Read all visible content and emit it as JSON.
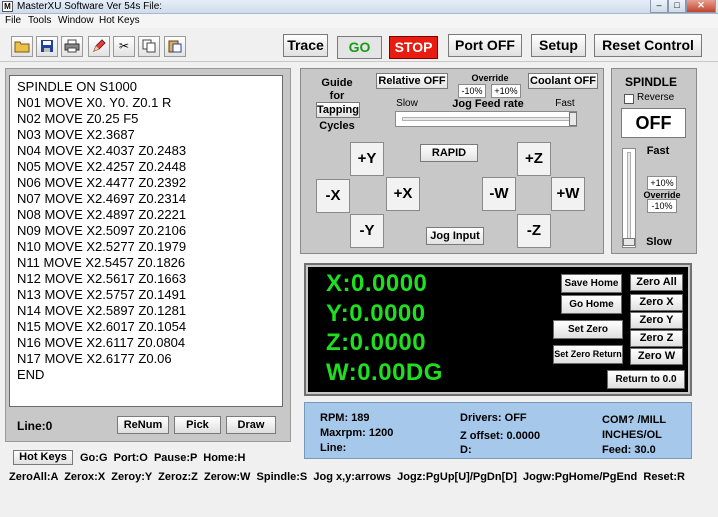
{
  "window": {
    "title": "MasterXU Software Ver 54s File:"
  },
  "menu": [
    "File",
    "Tools",
    "Window",
    "Hot Keys"
  ],
  "toolbar": {
    "tools": [
      "open-folder",
      "save",
      "print",
      "edit",
      "cut",
      "copy",
      "paste"
    ],
    "trace": "Trace",
    "go": "GO",
    "stop": "STOP",
    "port_off": "Port OFF",
    "setup": "Setup",
    "reset_control": "Reset Control"
  },
  "gcode": {
    "lines": [
      "SPINDLE ON S1000",
      "N01 MOVE X0. Y0. Z0.1 R",
      "N02 MOVE Z0.25 F5",
      "N03 MOVE X2.3687",
      "N04 MOVE X2.4037 Z0.2483",
      "N05 MOVE X2.4257 Z0.2448",
      "N06 MOVE X2.4477 Z0.2392",
      "N07 MOVE X2.4697 Z0.2314",
      "N08 MOVE X2.4897 Z0.2221",
      "N09 MOVE X2.5097 Z0.2106",
      "N10 MOVE X2.5277 Z0.1979",
      "N11 MOVE X2.5457 Z0.1826",
      "N12 MOVE X2.5617 Z0.1663",
      "N13 MOVE X2.5757 Z0.1491",
      "N14 MOVE X2.5897 Z0.1281",
      "N15 MOVE X2.6017 Z0.1054",
      "N16 MOVE X2.6117 Z0.0804",
      "N17 MOVE X2.6177 Z0.06",
      "END"
    ],
    "line_label": "Line:0",
    "renum": "ReNum",
    "pick": "Pick",
    "draw": "Draw"
  },
  "jog": {
    "guide_for": "Guide\nfor",
    "tapping": "Tapping",
    "cycles": "Cycles",
    "relative_off": "Relative OFF",
    "override": "Override",
    "minus10": "-10%",
    "plus10": "+10%",
    "jog_feed_rate": "Jog Feed rate",
    "coolant_off": "Coolant OFF",
    "slow": "Slow",
    "fast": "Fast",
    "feed_level": 1.0,
    "rapid": "RAPID",
    "plus_y": "+Y",
    "minus_y": "-Y",
    "minus_x": "-X",
    "plus_x": "+X",
    "plus_z": "+Z",
    "minus_z": "-Z",
    "minus_w": "-W",
    "plus_w": "+W",
    "jog_input": "Jog Input"
  },
  "spindle": {
    "title": "SPINDLE",
    "reverse": "Reverse",
    "off": "OFF",
    "fast": "Fast",
    "plus10": "+10%",
    "override": "Override",
    "minus10": "-10%",
    "slow": "Slow",
    "level": 0.0
  },
  "dro": {
    "x": "X:0.0000",
    "y": "Y:0.0000",
    "z": "Z:0.0000",
    "w": "W:0.00DG",
    "save_home": "Save Home",
    "go_home": "Go Home",
    "set_zero": "Set Zero",
    "set_zero_return": "Set Zero Return",
    "zero_all": "Zero All",
    "zero_x": "Zero X",
    "zero_y": "Zero Y",
    "zero_z": "Zero Z",
    "zero_w": "Zero W",
    "return_to_zero": "Return to 0.0"
  },
  "status": {
    "rpm": "RPM: 189",
    "maxrpm": "Maxrpm: 1200",
    "line": "Line:",
    "drivers": "Drivers: OFF",
    "z_offset": "Z offset: 0.0000",
    "d": "D:",
    "com": "COM? /MILL",
    "units": "INCHES/OL",
    "feed": "Feed: 30.0"
  },
  "hotkeys": {
    "button": "Hot Keys",
    "line1": "Go:G  Port:O  Pause:P  Home:H",
    "line2": "ZeroAll:A  Zerox:X  Zeroy:Y  Zeroz:Z  Zerow:W  Spindle:S  Jog x,y:arrows  Jogz:PgUp[U]/PgDn[D]  Jogw:PgHome/PgEnd  Reset:R"
  }
}
